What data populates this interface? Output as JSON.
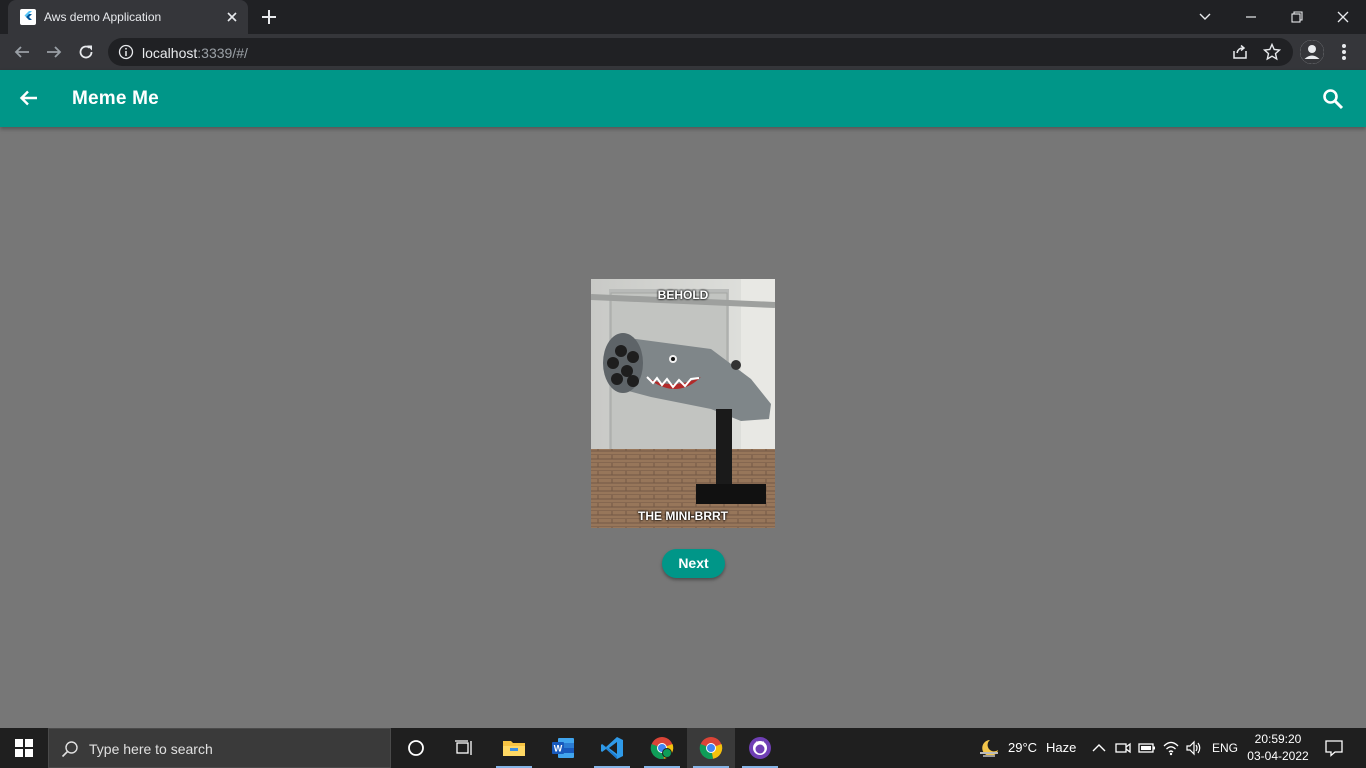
{
  "browser": {
    "tab_title": "Aws demo Application",
    "url_host": "localhost",
    "url_rest": ":3339/#/"
  },
  "appbar": {
    "title": "Meme Me"
  },
  "meme": {
    "top_text": "BEHOLD",
    "bottom_text": "THE MINI-BRRT"
  },
  "next_button": {
    "label": "Next"
  },
  "taskbar": {
    "search_placeholder": "Type here to search",
    "weather_temp": "29°C",
    "weather_desc": "Haze",
    "language": "ENG",
    "time": "20:59:20",
    "date": "03-04-2022"
  },
  "colors": {
    "accent": "#009688",
    "background": "#777777"
  }
}
